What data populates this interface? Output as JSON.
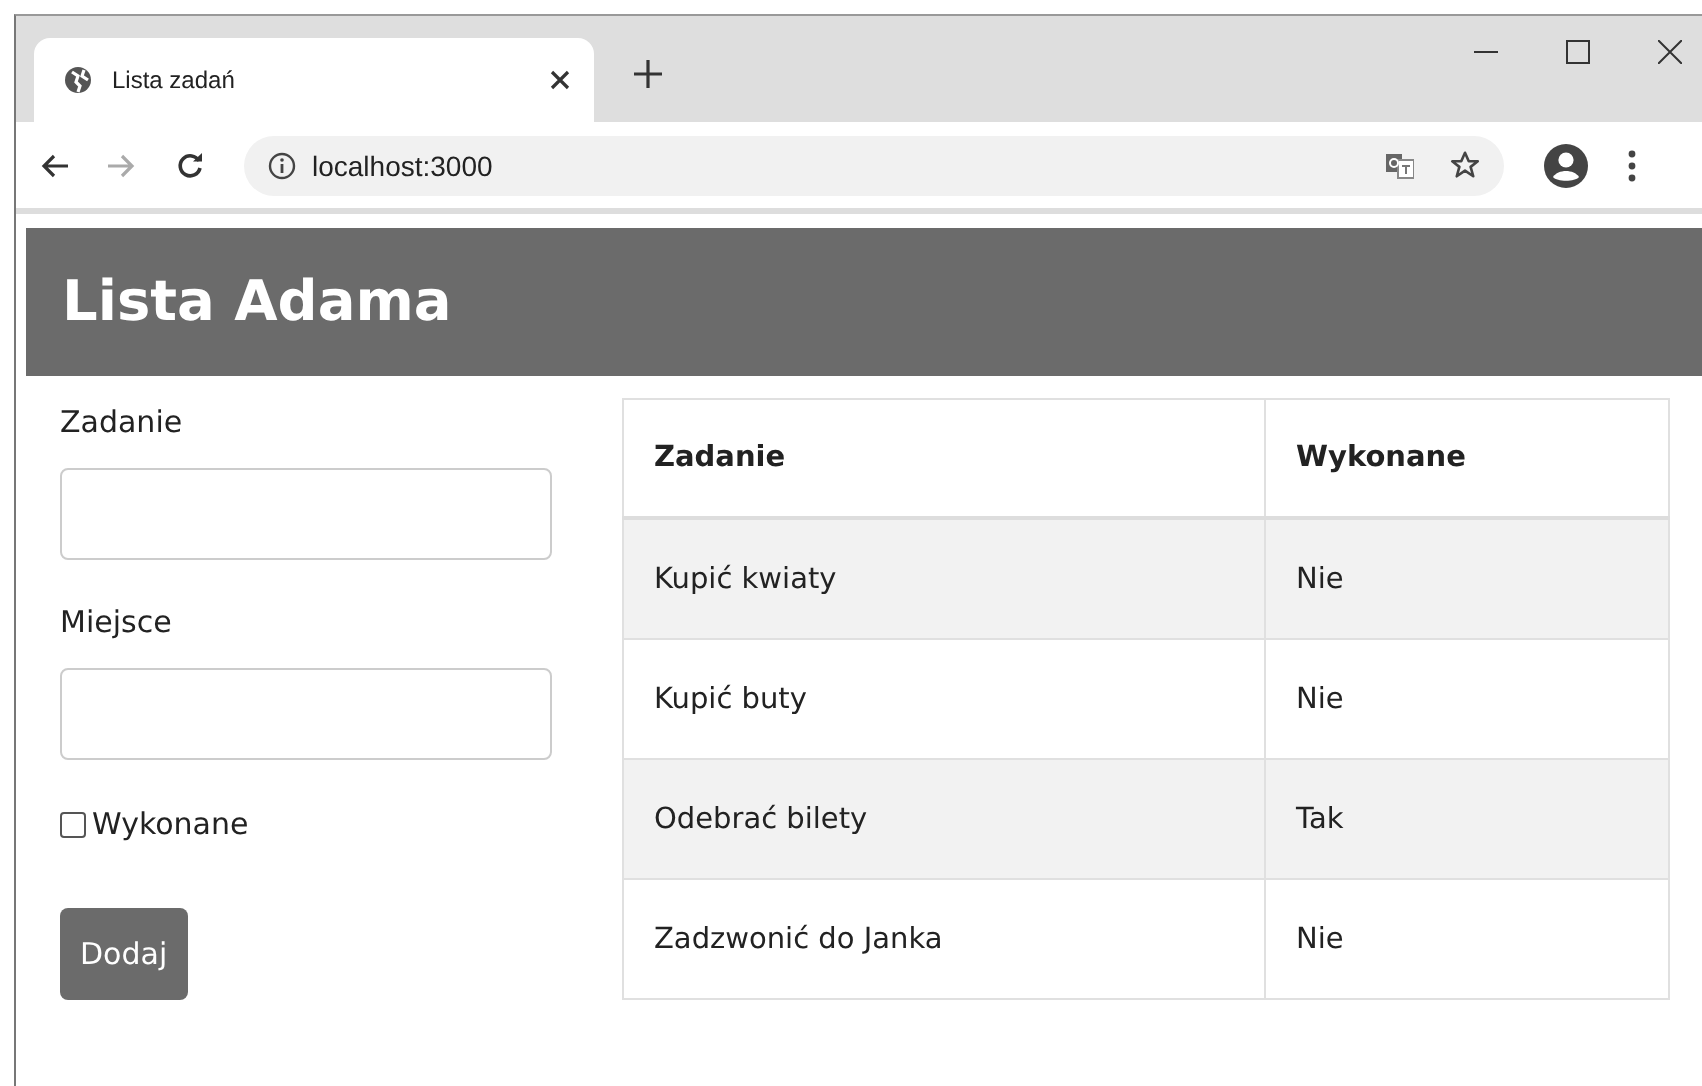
{
  "browser": {
    "tab": {
      "title": "Lista zadań"
    },
    "address": "localhost:3000"
  },
  "header": {
    "title": "Lista Adama"
  },
  "form": {
    "fields": [
      {
        "label": "Zadanie"
      },
      {
        "label": "Miejsce"
      }
    ],
    "checkbox": {
      "label": "Wykonane",
      "checked": false
    },
    "button": "Dodaj"
  },
  "table": {
    "columns": [
      "Zadanie",
      "Wykonane"
    ],
    "rows": [
      {
        "cells": [
          "Kupić kwiaty",
          "Nie"
        ]
      },
      {
        "cells": [
          "Kupić buty",
          "Nie"
        ]
      },
      {
        "cells": [
          "Odebrać bilety",
          "Tak"
        ]
      },
      {
        "cells": [
          "Zadzwonić do Janka",
          "Nie"
        ]
      }
    ]
  }
}
